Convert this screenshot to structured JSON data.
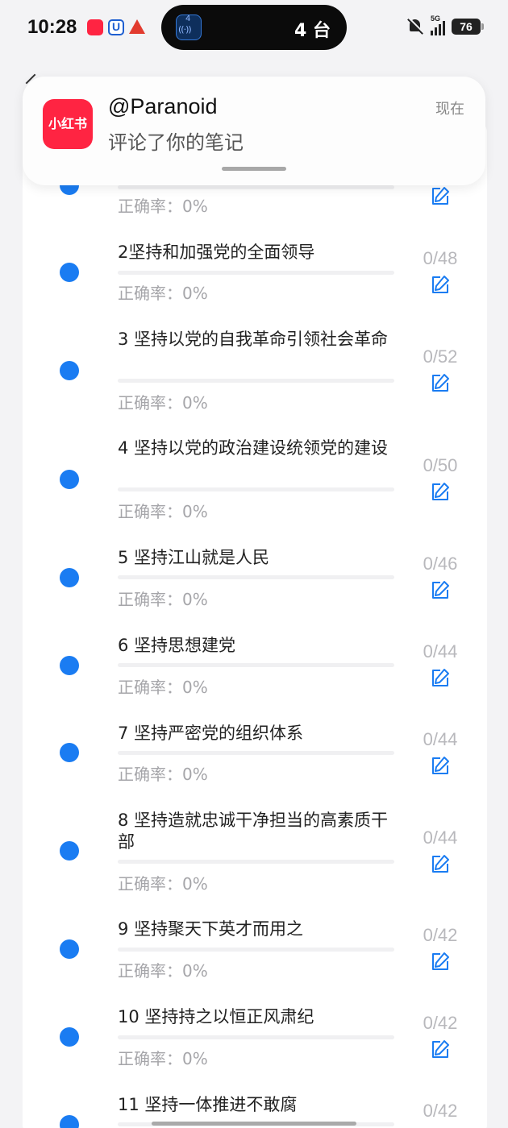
{
  "status_bar": {
    "time": "10:28",
    "island_text": "4 台",
    "network": "5G",
    "battery": "76"
  },
  "notification": {
    "app_icon_text": "小红书",
    "title": "@Paranoid",
    "body": "评论了你的笔记",
    "time": "现在"
  },
  "list": {
    "items": [
      {
        "title": "",
        "accuracy": "正确率：0%",
        "count": ""
      },
      {
        "title": "2坚持和加强党的全面领导",
        "accuracy": "正确率：0%",
        "count": "0/48"
      },
      {
        "title": "3 坚持以党的自我革命引领社会革命",
        "accuracy": "正确率：0%",
        "count": "0/52"
      },
      {
        "title": "4 坚持以党的政治建设统领党的建设",
        "accuracy": "正确率：0%",
        "count": "0/50"
      },
      {
        "title": "5 坚持江山就是人民",
        "accuracy": "正确率：0%",
        "count": "0/46"
      },
      {
        "title": "6 坚持思想建党",
        "accuracy": "正确率：0%",
        "count": "0/44"
      },
      {
        "title": "7 坚持严密党的组织体系",
        "accuracy": "正确率：0%",
        "count": "0/44"
      },
      {
        "title": "8 坚持造就忠诚干净担当的高素质干部",
        "accuracy": "正确率：0%",
        "count": "0/44"
      },
      {
        "title": "9 坚持聚天下英才而用之",
        "accuracy": "正确率：0%",
        "count": "0/42"
      },
      {
        "title": "10 坚持持之以恒正风肃纪",
        "accuracy": "正确率：0%",
        "count": "0/42"
      },
      {
        "title": "11 坚持一体推进不敢腐",
        "accuracy": "",
        "count": "0/42"
      }
    ]
  },
  "colors": {
    "accent": "#1a7cf2",
    "brand_red": "#ff2442"
  }
}
